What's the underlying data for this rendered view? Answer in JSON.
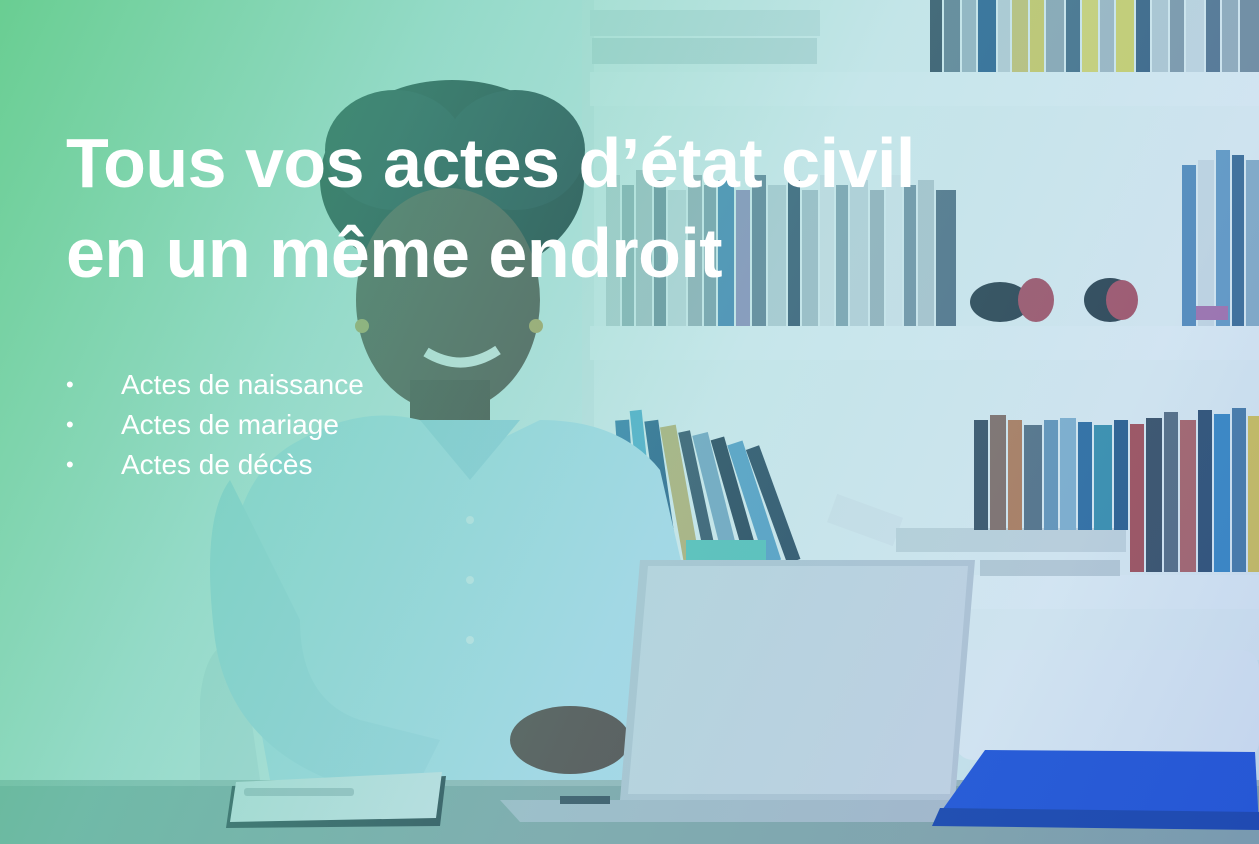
{
  "headline": {
    "line1": "Tous vos actes d’état civil",
    "line2": "en un même endroit"
  },
  "bullets": [
    {
      "marker": "•",
      "label": "Actes de naissance"
    },
    {
      "marker": "•",
      "label": "Actes de mariage"
    },
    {
      "marker": "•",
      "label": "Actes de décès"
    }
  ],
  "colors": {
    "overlay_green": "#48c478",
    "overlay_blue": "#3c6ed2",
    "text": "#ffffff",
    "folder_blue": "#1f4fd6"
  }
}
